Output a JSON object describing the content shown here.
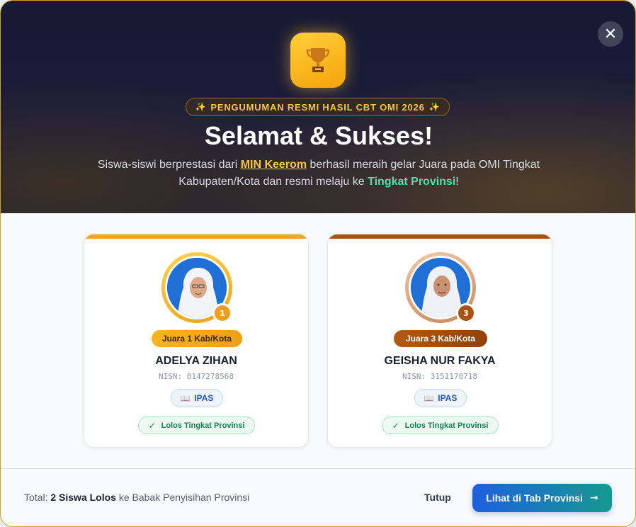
{
  "hero": {
    "badge": "PENGUMUMAN RESMI HASIL CBT OMI 2026",
    "badge_spark": "✨",
    "title": "Selamat & Sukses!",
    "subtitle_1": "Siswa-siswi berprestasi dari ",
    "school": "MIN Keerom",
    "subtitle_2": " berhasil meraih gelar Juara pada OMI Tingkat Kabupaten/Kota dan resmi melaju ke ",
    "level": "Tingkat Provinsi",
    "subtitle_3": "!",
    "close_icon": "✕"
  },
  "students": [
    {
      "rank": "Juara 1 Kab/Kota",
      "name": "ADELYA ZIHAN",
      "nisn": "NISN: 0147278568",
      "subject": "IPAS",
      "status": "Lolos Tingkat Provinsi",
      "medal": "1",
      "accent": "#f2a51a",
      "medal_icon": "gold-medal-icon"
    },
    {
      "rank": "Juara 3 Kab/Kota",
      "name": "GEISHA NUR FAKYA",
      "nisn": "NISN: 3151170718",
      "subject": "IPAS",
      "status": "Lolos Tingkat Provinsi",
      "medal": "3",
      "accent": "#a9530f",
      "medal_icon": "bronze-medal-icon"
    }
  ],
  "footer": {
    "total_prefix": "Total: ",
    "total_count": "2 Siswa Lolos",
    "total_suffix": " ke Babak Penyisihan Provinsi",
    "close_label": "Tutup",
    "primary_label": "Lihat di Tab Provinsi",
    "primary_arrow": "→"
  },
  "icons": {
    "book": "📖",
    "check": "✓"
  }
}
